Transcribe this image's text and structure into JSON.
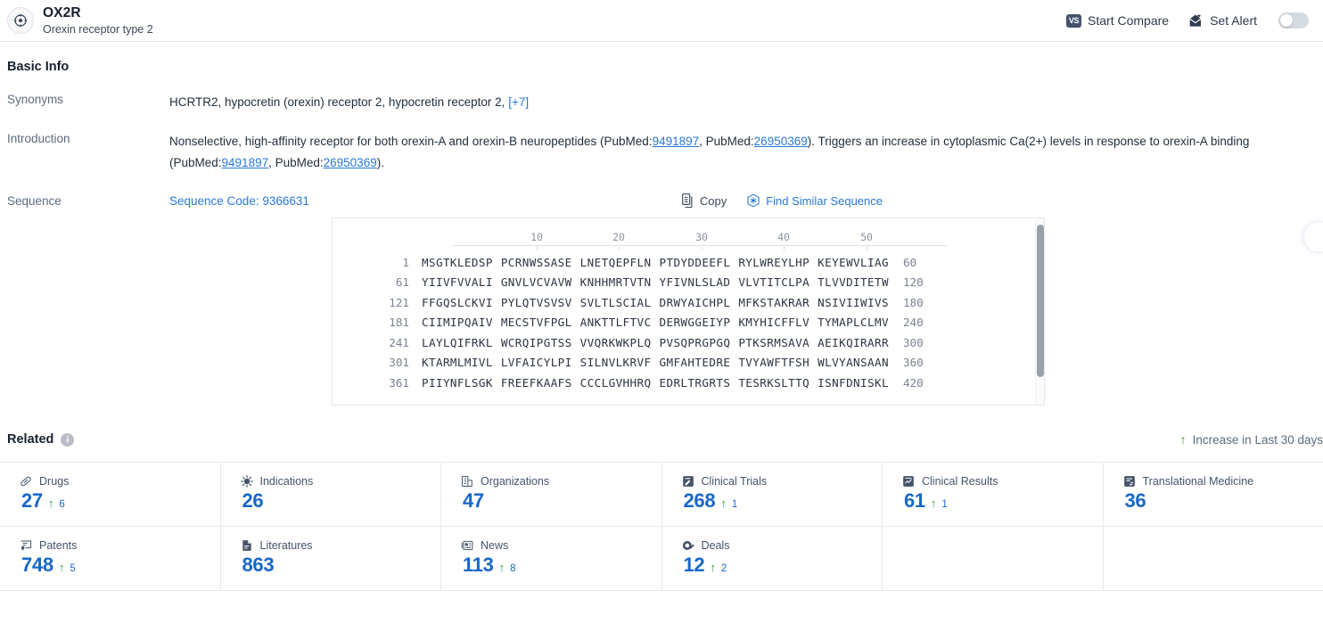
{
  "header": {
    "title": "OX2R",
    "subtitle": "Orexin receptor type 2",
    "logo_icon": "target-crosshair-icon",
    "start_compare_label": "Start Compare",
    "vs_badge": "VS",
    "set_alert_label": "Set Alert",
    "alert_toggle_state": "off"
  },
  "basic_info": {
    "section_title": "Basic Info",
    "synonyms": {
      "label": "Synonyms",
      "value": "HCRTR2,  hypocretin (orexin) receptor 2,  hypocretin receptor 2,",
      "more": "[+7]"
    },
    "introduction": {
      "label": "Introduction",
      "part1": "Nonselective, high-affinity receptor for both orexin-A and orexin-B neuropeptides (PubMed:",
      "pmid1": "9491897",
      "part2": ", PubMed:",
      "pmid2": "26950369",
      "part3": "). Triggers an increase in cytoplasmic Ca(2+) levels in response to orexin-A binding (PubMed:",
      "pmid3": "9491897",
      "part4": ", PubMed:",
      "pmid4": "26950369",
      "part5": ")."
    },
    "sequence": {
      "label": "Sequence",
      "code_label": "Sequence Code: 9366631",
      "copy_label": "Copy",
      "copy_icon": "copy-icon",
      "find_similar_label": "Find Similar Sequence",
      "find_similar_icon": "find-similar-sequence-icon",
      "ruler_ticks": [
        "10",
        "20",
        "30",
        "40",
        "50"
      ],
      "rows": [
        {
          "start": "1",
          "chunks": [
            "MSGTKLEDSP",
            "PCRNWSSASE",
            "LNETQEPFLN",
            "PTDYDDEEFL",
            "RYLWREYLHP",
            "KEYEWVLIAG"
          ],
          "end": "60"
        },
        {
          "start": "61",
          "chunks": [
            "YIIVFVVALI",
            "GNVLVCVAVW",
            "KNHHMRTVTN",
            "YFIVNLSLAD",
            "VLVTITCLPA",
            "TLVVDITETW"
          ],
          "end": "120"
        },
        {
          "start": "121",
          "chunks": [
            "FFGQSLCKVI",
            "PYLQTVSVSV",
            "SVLTLSCIAL",
            "DRWYAICHPL",
            "MFKSTAKRAR",
            "NSIVIIWIVS"
          ],
          "end": "180"
        },
        {
          "start": "181",
          "chunks": [
            "CIIMIPQAIV",
            "MECSTVFPGL",
            "ANKTTLFTVC",
            "DERWGGEIYP",
            "KMYHICFFLV",
            "TYMAPLCLMV"
          ],
          "end": "240"
        },
        {
          "start": "241",
          "chunks": [
            "LAYLQIFRKL",
            "WCRQIPGTSS",
            "VVQRKWKPLQ",
            "PVSQPRGPGQ",
            "PTKSRMSAVA",
            "AEIKQIRARR"
          ],
          "end": "300"
        },
        {
          "start": "301",
          "chunks": [
            "KTARMLMIVL",
            "LVFAICYLPI",
            "SILNVLKRVF",
            "GMFAHTEDRE",
            "TVYAWFTFSH",
            "WLVYANSAAN"
          ],
          "end": "360"
        },
        {
          "start": "361",
          "chunks": [
            "PIIYNFLSGK",
            "FREEFKAAFS",
            "CCCLGVHHRQ",
            "EDRLTRGRTS",
            "TESRKSLTTQ",
            "ISNFDNISKL"
          ],
          "end": "420"
        }
      ]
    }
  },
  "related": {
    "section_title": "Related",
    "info_icon": "info-icon",
    "increase_note": "Increase in Last 30 days",
    "increase_arrow_icon": "arrow-up-icon",
    "rows": [
      [
        {
          "label": "Drugs",
          "icon": "pill-icon",
          "value": "27",
          "delta": "6"
        },
        {
          "label": "Indications",
          "icon": "virus-icon",
          "value": "26",
          "delta": ""
        },
        {
          "label": "Organizations",
          "icon": "building-icon",
          "value": "47",
          "delta": ""
        },
        {
          "label": "Clinical Trials",
          "icon": "clipboard-pen-icon",
          "value": "268",
          "delta": "1"
        },
        {
          "label": "Clinical Results",
          "icon": "chart-document-icon",
          "value": "61",
          "delta": "1"
        },
        {
          "label": "Translational Medicine",
          "icon": "transfer-document-icon",
          "value": "36",
          "delta": ""
        }
      ],
      [
        {
          "label": "Patents",
          "icon": "patent-icon",
          "value": "748",
          "delta": "5"
        },
        {
          "label": "Literatures",
          "icon": "literature-icon",
          "value": "863",
          "delta": ""
        },
        {
          "label": "News",
          "icon": "news-icon",
          "value": "113",
          "delta": "8"
        },
        {
          "label": "Deals",
          "icon": "deals-icon",
          "value": "12",
          "delta": "2"
        },
        {
          "label": "",
          "icon": "",
          "value": "",
          "delta": ""
        },
        {
          "label": "",
          "icon": "",
          "value": "",
          "delta": ""
        }
      ]
    ]
  },
  "colors": {
    "accent_blue": "#2878d5",
    "number_blue": "#1767c7",
    "increase_green": "#28a13f",
    "badge_slate": "#42526e"
  }
}
